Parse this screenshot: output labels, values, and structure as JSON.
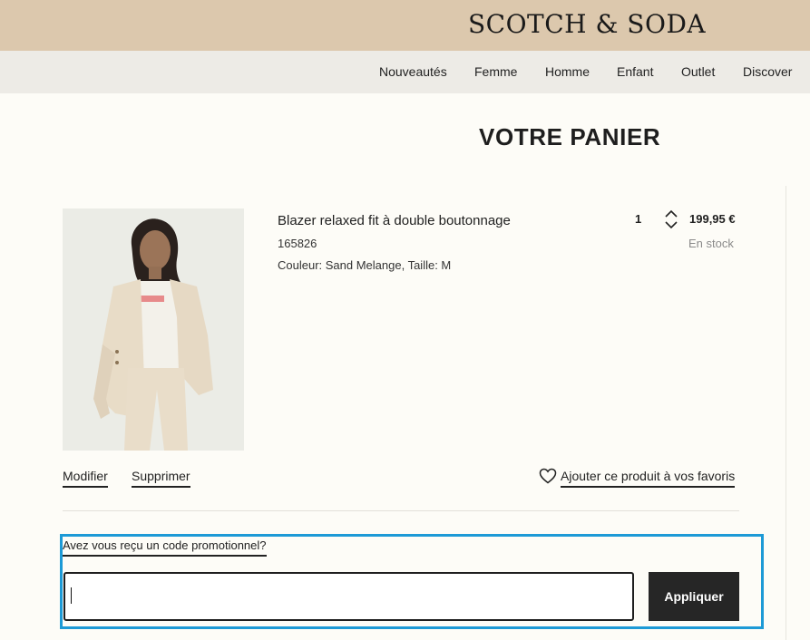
{
  "brand": {
    "logo_text": "SCOTCH & SODA"
  },
  "nav": {
    "items": [
      {
        "label": "Nouveautés"
      },
      {
        "label": "Femme"
      },
      {
        "label": "Homme"
      },
      {
        "label": "Enfant"
      },
      {
        "label": "Outlet"
      },
      {
        "label": "Discover"
      }
    ]
  },
  "cart": {
    "title": "VOTRE PANIER",
    "item": {
      "name": "Blazer relaxed fit à double boutonnage",
      "sku": "165826",
      "variant": "Couleur: Sand Melange, Taille: M",
      "quantity": "1",
      "price": "199,95 €",
      "stock": "En stock",
      "image_icon": "product-photo"
    },
    "actions": {
      "edit": "Modifier",
      "remove": "Supprimer",
      "favorite": "Ajouter ce produit à vos favoris"
    }
  },
  "promo": {
    "label": "Avez vous reçu un code promotionnel?",
    "input_value": "",
    "button": "Appliquer"
  },
  "colors": {
    "topbar": "#dcc8ad",
    "navbar": "#edebe6",
    "highlight": "#1d9ad6",
    "button": "#262626"
  }
}
